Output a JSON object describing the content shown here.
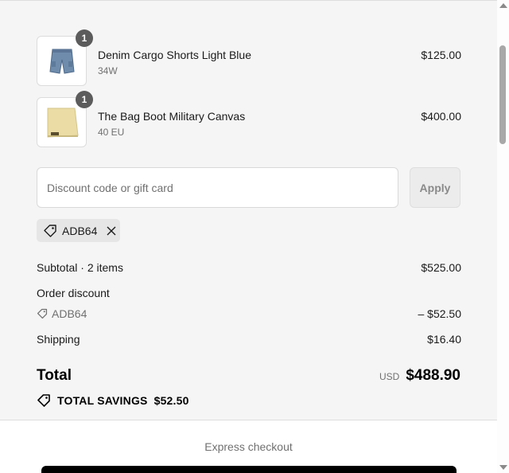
{
  "order_summary": {
    "line_items": [
      {
        "quantity": "1",
        "name": "Denim Cargo Shorts Light Blue",
        "variant": "34W",
        "price": "$125.00",
        "thumb_icon": "denim-shorts-image"
      },
      {
        "quantity": "1",
        "name": "The Bag Boot Military Canvas",
        "variant": "40 EU",
        "price": "$400.00",
        "thumb_icon": "canvas-bag-image"
      }
    ],
    "discount": {
      "placeholder": "Discount code or gift card",
      "value": "",
      "apply_label": "Apply",
      "applied_code": "ADB64"
    },
    "subtotal": {
      "label": "Subtotal · 2 items",
      "value": "$525.00"
    },
    "order_discount": {
      "label": "Order discount",
      "code": "ADB64",
      "value": "– $52.50"
    },
    "shipping": {
      "label": "Shipping",
      "value": "$16.40"
    },
    "total": {
      "label": "Total",
      "currency": "USD",
      "value": "$488.90"
    },
    "savings": {
      "label": "TOTAL SAVINGS",
      "value": "$52.50"
    }
  },
  "express_checkout": {
    "label": "Express checkout"
  },
  "colors": {
    "summary_bg": "#f5f5f5",
    "badge": "#5c5c5c",
    "express_button": "#000000"
  }
}
